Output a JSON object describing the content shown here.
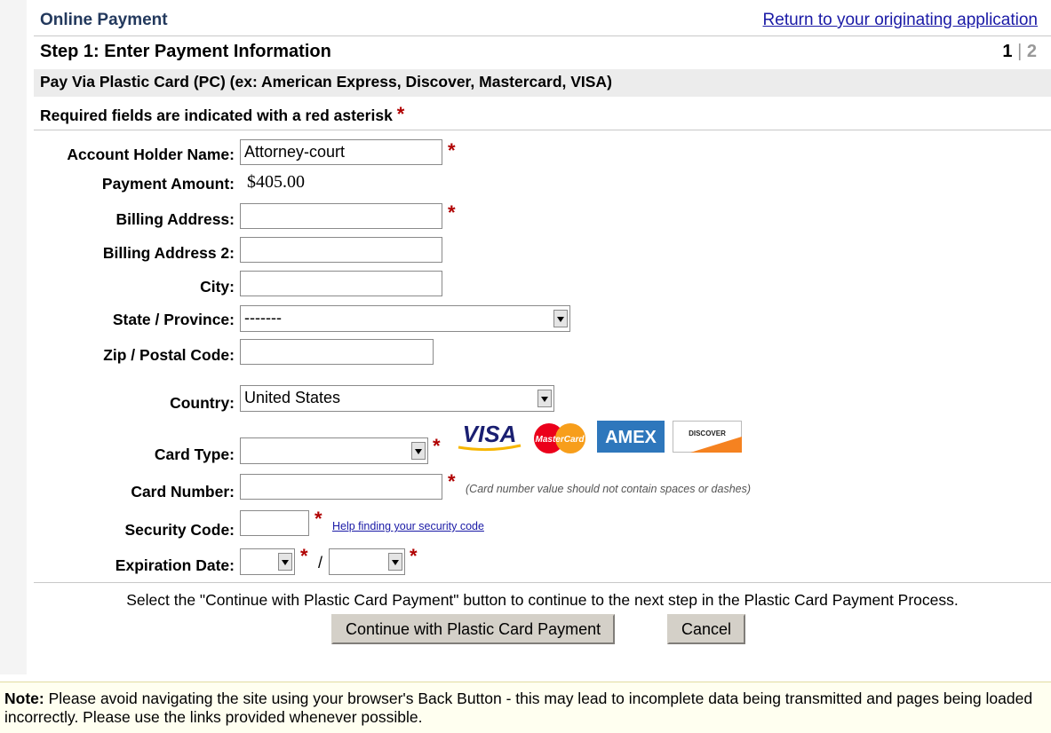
{
  "header": {
    "title": "Online Payment",
    "return_link": "Return to your originating application"
  },
  "step": {
    "title": "Step 1: Enter Payment Information",
    "current": "1",
    "separator": "|",
    "next": "2"
  },
  "method": {
    "text": "Pay Via Plastic Card (PC) (ex: American Express, Discover, Mastercard, VISA)"
  },
  "required_note": "Required fields are indicated with a red asterisk",
  "asterisk": "*",
  "form": {
    "account_holder_label": "Account Holder Name:",
    "account_holder_value": "Attorney-court",
    "payment_amount_label": "Payment Amount:",
    "payment_amount_value": "$405.00",
    "billing_address_label": "Billing Address:",
    "billing_address2_label": "Billing Address 2:",
    "city_label": "City:",
    "state_label": "State / Province:",
    "state_value": "-------",
    "zip_label": "Zip / Postal Code:",
    "country_label": "Country:",
    "country_value": "United States",
    "card_type_label": "Card Type:",
    "card_number_label": "Card Number:",
    "card_number_hint": "(Card number value should not contain spaces or dashes)",
    "security_code_label": "Security Code:",
    "security_help": "Help finding your security code",
    "expiration_label": "Expiration Date:",
    "expiration_sep": "/"
  },
  "cards": {
    "visa": "VISA",
    "mastercard": "MasterCard",
    "amex": "AMEX",
    "discover": "DISCOVER"
  },
  "colors": {
    "title": "#23395d",
    "link": "#1a1aa6",
    "asterisk": "#b00000",
    "visa_blue": "#1a1f71",
    "visa_gold": "#f7b600",
    "mc_red": "#eb001b",
    "mc_orange": "#f79e1b",
    "amex_blue": "#2e77bc",
    "discover_orange": "#f58220"
  },
  "instructions": "Select the \"Continue with Plastic Card Payment\" button to continue to the next step in the Plastic Card Payment Process.",
  "buttons": {
    "continue": "Continue with Plastic Card Payment",
    "cancel": "Cancel"
  },
  "footer_note": {
    "label": "Note:",
    "text": " Please avoid navigating the site using your browser's Back Button - this may lead to incomplete data being transmitted and pages being loaded incorrectly. Please use the links provided whenever possible."
  }
}
